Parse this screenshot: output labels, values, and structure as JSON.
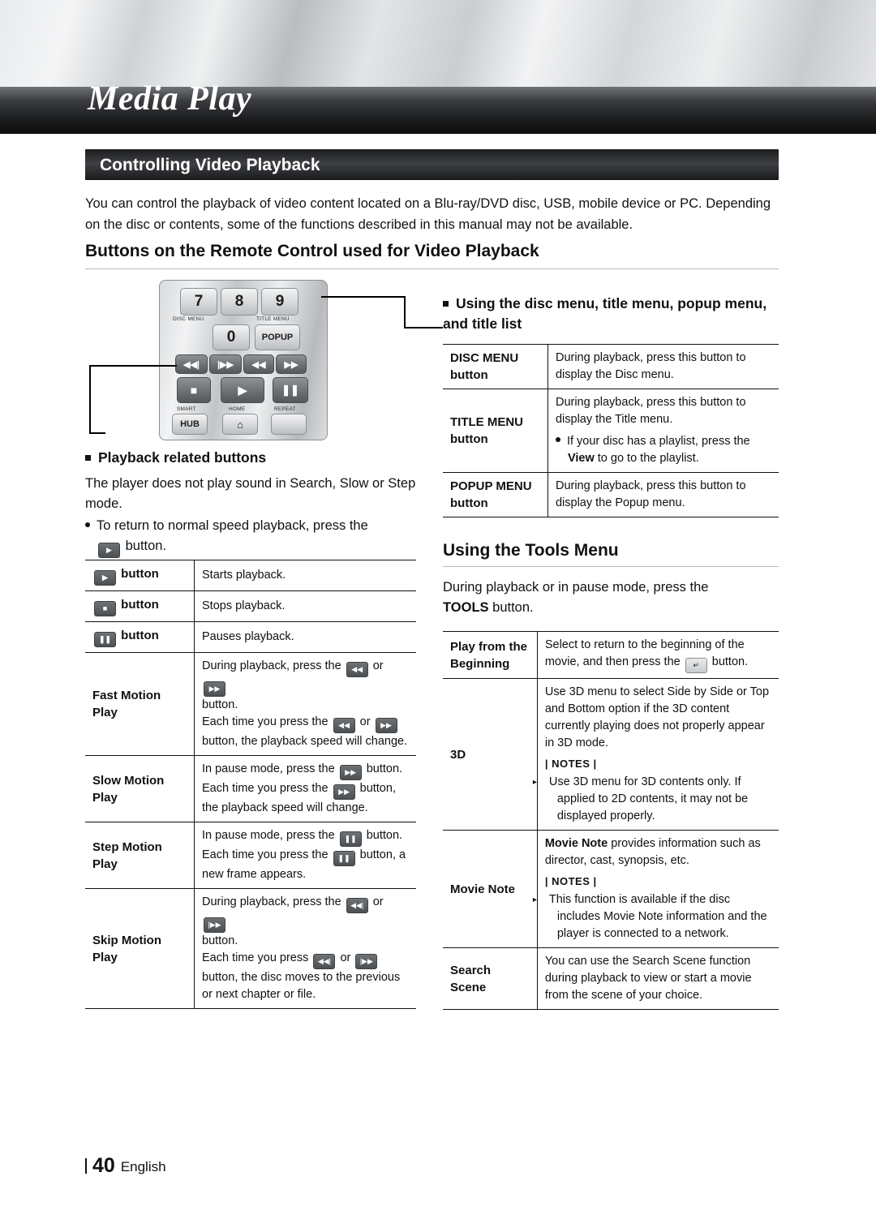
{
  "chapter": "Media Play",
  "section_title": "Controlling Video Playback",
  "intro": "You can control the playback of video content located on a Blu-ray/DVD disc, USB, mobile device or PC. Depending on the disc or contents, some of the functions described in this manual may not be available.",
  "heading_remote": "Buttons on the Remote Control used for Video Playback",
  "remote": {
    "keys": [
      {
        "label": "7",
        "sub": "DISC MENU"
      },
      {
        "label": "8",
        "sub": ""
      },
      {
        "label": "9",
        "sub": "TITLE MENU"
      },
      {
        "label": "0",
        "sub": ""
      },
      {
        "label": "POPUP",
        "sub": ""
      }
    ],
    "labels": {
      "disc_menu": "DISC MENU",
      "title_menu": "TITLE MENU",
      "popup": "POPUP",
      "smart": "SMART",
      "hub": "HUB",
      "home": "HOME",
      "repeat": "REPEAT"
    }
  },
  "playback_section": {
    "bullet_heading": "Playback related buttons",
    "paragraph": "The player does not play sound in Search, Slow or Step mode.",
    "dot_line_a": "To return to normal speed playback, press the",
    "dot_line_b": "button."
  },
  "playback_table": [
    {
      "label": "button",
      "label_icon": "play",
      "desc": "Starts playback."
    },
    {
      "label": "button",
      "label_icon": "stop",
      "desc": "Stops playback."
    },
    {
      "label": "button",
      "label_icon": "pause",
      "desc": "Pauses playback."
    },
    {
      "label": "Fast Motion Play",
      "label_icon": "",
      "desc_line1": "During playback, press the",
      "desc_mid": "or",
      "desc_line2": "button.",
      "desc_line3": "Each time you press the",
      "desc_line4": "button, the playback speed will change."
    },
    {
      "label": "Slow Motion Play",
      "label_icon": "",
      "desc_line1": "In pause mode, press the",
      "desc_line2": "button.",
      "desc_line3": "Each time you press the",
      "desc_line4": "button, the playback speed will change."
    },
    {
      "label": "Step Motion Play",
      "label_icon": "",
      "desc_line1": "In pause mode, press the",
      "desc_line2": "button.",
      "desc_line3": "Each time you press the",
      "desc_line4": "button, a new frame appears."
    },
    {
      "label": "Skip Motion Play",
      "label_icon": "",
      "desc_line1": "During playback, press the",
      "desc_mid": "or",
      "desc_line2": "button.",
      "desc_line3": "Each time you press",
      "desc_line4": "or",
      "desc_line5": "button, the disc moves to the previous or next chapter or file."
    }
  ],
  "disc_menu_section": {
    "bullet_heading": "Using the disc menu, title menu, popup menu, and title list",
    "rows": [
      {
        "label": "DISC MENU button",
        "desc": "During playback, press this button to display the Disc menu."
      },
      {
        "label": "TITLE MENU button",
        "desc": "During playback, press this button to display the Title menu.",
        "note": "If your disc has a playlist, press the View to go to the playlist.",
        "note_pre": "If your disc has a playlist, press the",
        "note_bold": "View",
        "note_post": "to go to the playlist."
      },
      {
        "label": "POPUP MENU button",
        "desc": "During playback, press this button to display the Popup menu."
      }
    ]
  },
  "tools_section": {
    "heading": "Using the Tools Menu",
    "intro_pre": "During playback or in pause mode, press the",
    "intro_bold": "TOOLS",
    "intro_post": "button.",
    "rows": [
      {
        "label": "Play from the Beginning",
        "desc_pre": "Select to return to the beginning of the movie, and then press the",
        "desc_post": "button."
      },
      {
        "label": "3D",
        "desc": "Use 3D menu to select Side by Side or Top and Bottom option if the 3D content currently playing does not properly appear in 3D mode.",
        "notes_label": "| NOTES |",
        "notes": [
          "Use 3D menu for 3D contents only. If applied to 2D contents, it may not be displayed properly."
        ]
      },
      {
        "label": "Movie Note",
        "desc_bold": "Movie Note",
        "desc": "provides information such as director, cast, synopsis, etc.",
        "notes_label": "| NOTES |",
        "notes": [
          "This function is available if the disc includes Movie Note information and the player is connected to a network."
        ]
      },
      {
        "label": "Search Scene",
        "desc": "You can use the Search Scene function during playback to view or start a movie from the scene of your choice."
      }
    ]
  },
  "footer": {
    "page": "40",
    "language": "English"
  }
}
